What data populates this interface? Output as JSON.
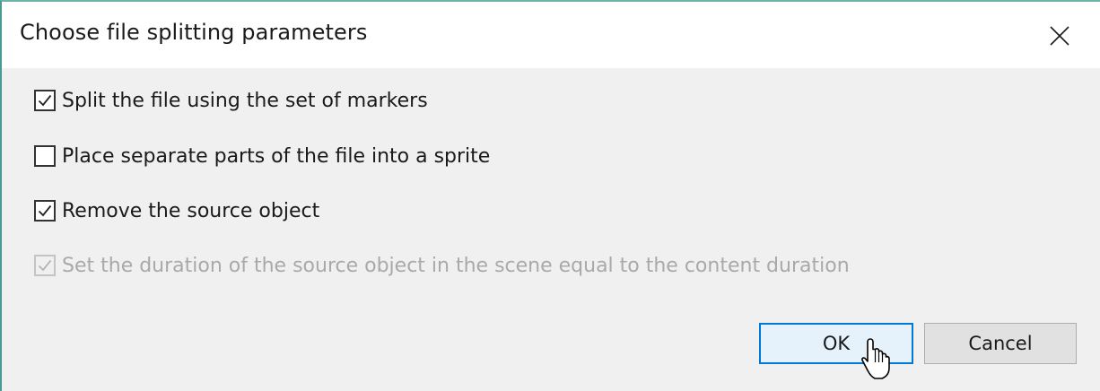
{
  "dialog": {
    "title": "Choose file splitting parameters",
    "options": [
      {
        "label": "Split the file using the set of markers",
        "checked": true,
        "enabled": true
      },
      {
        "label": "Place separate parts of the file into a sprite",
        "checked": false,
        "enabled": true
      },
      {
        "label": "Remove the source object",
        "checked": true,
        "enabled": true
      },
      {
        "label": "Set the duration of the source object in the scene equal to the content duration",
        "checked": true,
        "enabled": false
      }
    ],
    "buttons": {
      "ok_label": "OK",
      "cancel_label": "Cancel"
    },
    "icons": {
      "close": "close-icon",
      "check": "checkmark-icon",
      "cursor": "mouse-pointer-icon"
    },
    "colors": {
      "accent": "#0078d7",
      "ok_fill": "#e5f1fb",
      "body_bg": "#f0f0f0",
      "disabled_text": "#a9a9a9"
    }
  }
}
